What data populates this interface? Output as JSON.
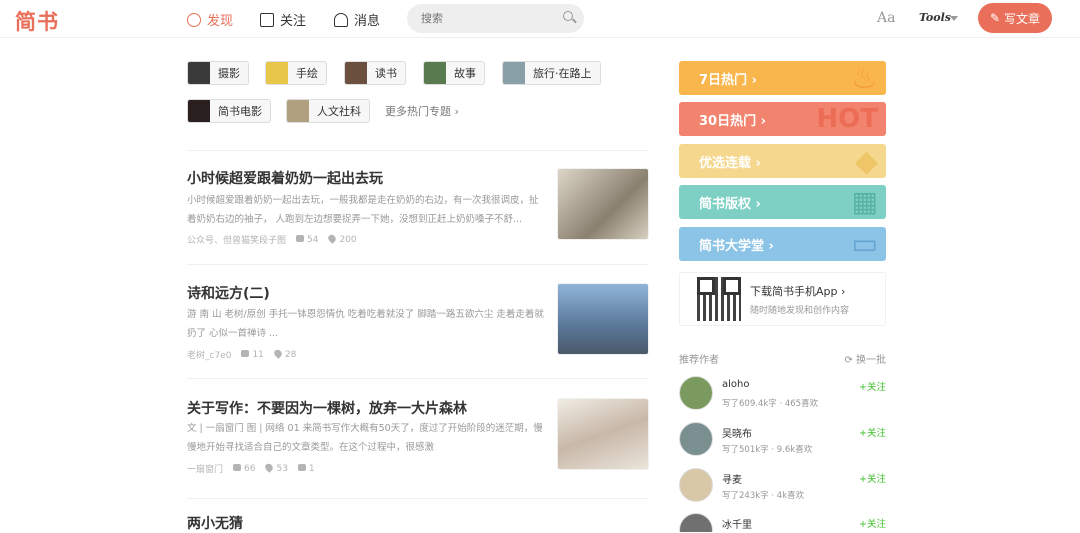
{
  "header": {
    "logo": "简书",
    "nav": [
      {
        "label": "发现",
        "icon": "compass-icon"
      },
      {
        "label": "关注",
        "icon": "follow-icon"
      },
      {
        "label": "消息",
        "icon": "bell-icon"
      }
    ],
    "search_placeholder": "搜索",
    "font_toggle": "Aa",
    "tools_label": "Tools",
    "write_label": "写文章",
    "accent": "#ea6f5a"
  },
  "topics": [
    {
      "label": "摄影",
      "color": "#3a3a3a"
    },
    {
      "label": "手绘",
      "color": "#e8c64a"
    },
    {
      "label": "读书",
      "color": "#6b5040"
    },
    {
      "label": "故事",
      "color": "#5a7a50"
    },
    {
      "label": "旅行·在路上",
      "color": "#8aa0a8"
    },
    {
      "label": "简书电影",
      "color": "#2b2020"
    },
    {
      "label": "人文社科",
      "color": "#b0a080"
    }
  ],
  "more_topics": "更多热门专题 ›",
  "articles": [
    {
      "title": "小时候超爱跟着奶奶一起出去玩",
      "abstract": "小时候超爱跟着奶奶一起出去玩，一般我都是走在奶奶的右边，有一次我很调皮，扯着奶奶右边的袖子， 人跑到左边想要捉弄一下她，没想到正赶上奶奶嗓子不舒...",
      "author": "公众号、但曾猫笑段子图",
      "comments": "54",
      "likes": "200",
      "img_color": "#b8b0a0"
    },
    {
      "title": "诗和远方(二)",
      "abstract": "游 南 山 老树/原创 手托一钵恩怨情仇 吃着吃着就没了 脚踏一路五欲六尘 走着走着就扔了 心似一首禅诗 ...",
      "author": "老树_c7e0",
      "comments": "11",
      "likes": "28",
      "img_color": "#6a8aa8"
    },
    {
      "title": "关于写作：不要因为一棵树，放弃一大片森林",
      "abstract": "文 | 一扇窗门 图 | 网络 01 来简书写作大概有50天了，度过了开始阶段的迷茫期，慢慢地开始寻找适合自己的文章类型。在这个过程中，很感激",
      "author": "一扇窗门",
      "comments": "66",
      "likes": "53",
      "rewards": "1",
      "img_color": "#c8b8a8"
    },
    {
      "title": "两小无猜"
    }
  ],
  "banners": [
    {
      "label": "7日热门 ›",
      "color": "#f9b64c",
      "deco": "🔥"
    },
    {
      "label": "30日热门 ›",
      "color": "#f2836e",
      "deco": "HOT"
    },
    {
      "label": "优选连载 ›",
      "color": "#f5d88d",
      "deco": "◆"
    },
    {
      "label": "简书版权 ›",
      "color": "#7fd0c4",
      "deco": "▦"
    },
    {
      "label": "简书大学堂 ›",
      "color": "#8bc4e6",
      "deco": "▭"
    }
  ],
  "app_download": {
    "title": "下载简书手机App ›",
    "subtitle": "随时随地发现和创作内容"
  },
  "recommend": {
    "title": "推荐作者",
    "switch": "换一批"
  },
  "authors": [
    {
      "name": "aloho",
      "stat": "写了609.4k字 · 465喜欢",
      "follow": "+关注",
      "color": "#7a9a60"
    },
    {
      "name": "吴晓布",
      "stat": "写了501k字 · 9.6k喜欢",
      "follow": "+关注",
      "color": "#7a9090"
    },
    {
      "name": "寻麦",
      "stat": "写了243k字 · 4k喜欢",
      "follow": "+关注",
      "color": "#d8c8a8"
    },
    {
      "name": "冰千里",
      "stat": "",
      "follow": "+关注",
      "color": "#707070"
    }
  ]
}
